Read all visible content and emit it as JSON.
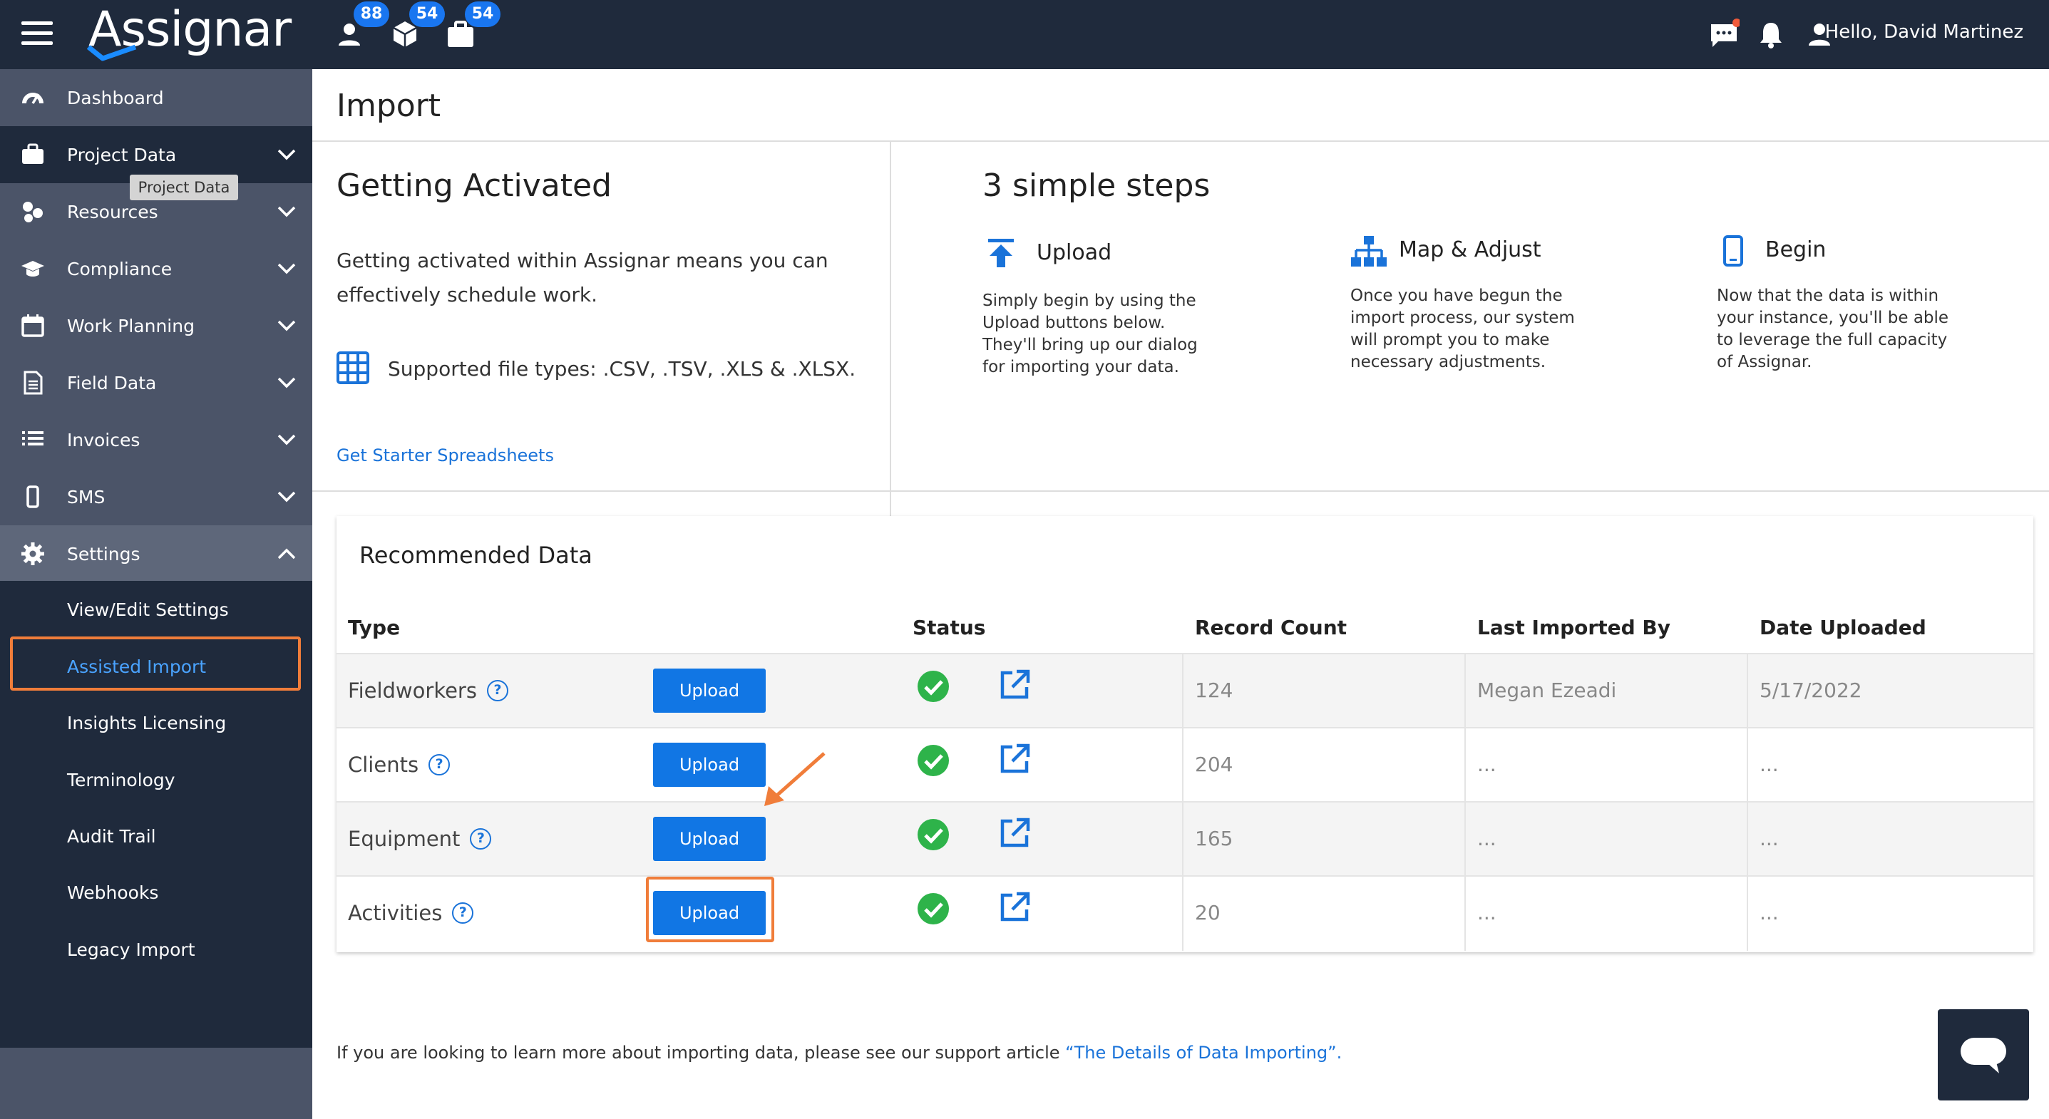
{
  "topbar": {
    "logo_text": "Assignar",
    "badges": [
      "88",
      "54",
      "54"
    ],
    "greeting": "Hello, David Martinez"
  },
  "sidebar": {
    "tooltip": "Project Data",
    "items": [
      {
        "label": "Dashboard",
        "icon": "dashboard-icon"
      },
      {
        "label": "Project Data",
        "icon": "briefcase-icon"
      },
      {
        "label": "Resources",
        "icon": "resources-icon"
      },
      {
        "label": "Compliance",
        "icon": "graduation-cap-icon"
      },
      {
        "label": "Work Planning",
        "icon": "calendar-icon"
      },
      {
        "label": "Field Data",
        "icon": "document-icon"
      },
      {
        "label": "Invoices",
        "icon": "list-icon"
      },
      {
        "label": "SMS",
        "icon": "mobile-icon"
      },
      {
        "label": "Settings",
        "icon": "gear-icon"
      }
    ],
    "settings_sub": [
      {
        "label": "View/Edit Settings"
      },
      {
        "label": "Assisted Import"
      },
      {
        "label": "Insights Licensing"
      },
      {
        "label": "Terminology"
      },
      {
        "label": "Audit Trail"
      },
      {
        "label": "Webhooks"
      },
      {
        "label": "Legacy Import"
      }
    ]
  },
  "main": {
    "page_title": "Import",
    "activated": {
      "title": "Getting Activated",
      "desc_line1": "Getting activated within Assignar means you can",
      "desc_line2": "effectively schedule work.",
      "file_types": "Supported file types: .CSV, .TSV, .XLS & .XLSX.",
      "starter_link": "Get Starter Spreadsheets"
    },
    "steps": {
      "title": "3 simple steps",
      "items": [
        {
          "title": "Upload",
          "lines": [
            "Simply begin by using the",
            "Upload buttons below.",
            "They'll bring up our dialog",
            "for importing your data."
          ]
        },
        {
          "title": "Map & Adjust",
          "lines": [
            "Once you have begun the",
            "import process, our system",
            "will prompt you to make",
            "necessary adjustments."
          ]
        },
        {
          "title": "Begin",
          "lines": [
            "Now that the data is within",
            "your instance, you'll be able",
            "to leverage the full capacity",
            "of Assignar."
          ]
        }
      ]
    },
    "recommended": {
      "title": "Recommended Data",
      "headers": {
        "type": "Type",
        "status": "Status",
        "record_count": "Record Count",
        "last_imported_by": "Last Imported By",
        "date_uploaded": "Date Uploaded"
      },
      "upload_label": "Upload",
      "rows": [
        {
          "type": "Fieldworkers",
          "count": "124",
          "by": "Megan Ezeadi",
          "date": "5/17/2022"
        },
        {
          "type": "Clients",
          "count": "204",
          "by": "...",
          "date": "..."
        },
        {
          "type": "Equipment",
          "count": "165",
          "by": "...",
          "date": "..."
        },
        {
          "type": "Activities",
          "count": "20",
          "by": "...",
          "date": "..."
        }
      ]
    },
    "footer": {
      "text": "If you are looking to learn more about importing data, please see our support article ",
      "link": "“The Details of Data Importing”."
    }
  },
  "colors": {
    "accent": "#1176e4",
    "navy": "#1f2a3c",
    "sidebar": "#4b5468",
    "highlight": "#f07d3a",
    "success": "#2eb34a"
  }
}
